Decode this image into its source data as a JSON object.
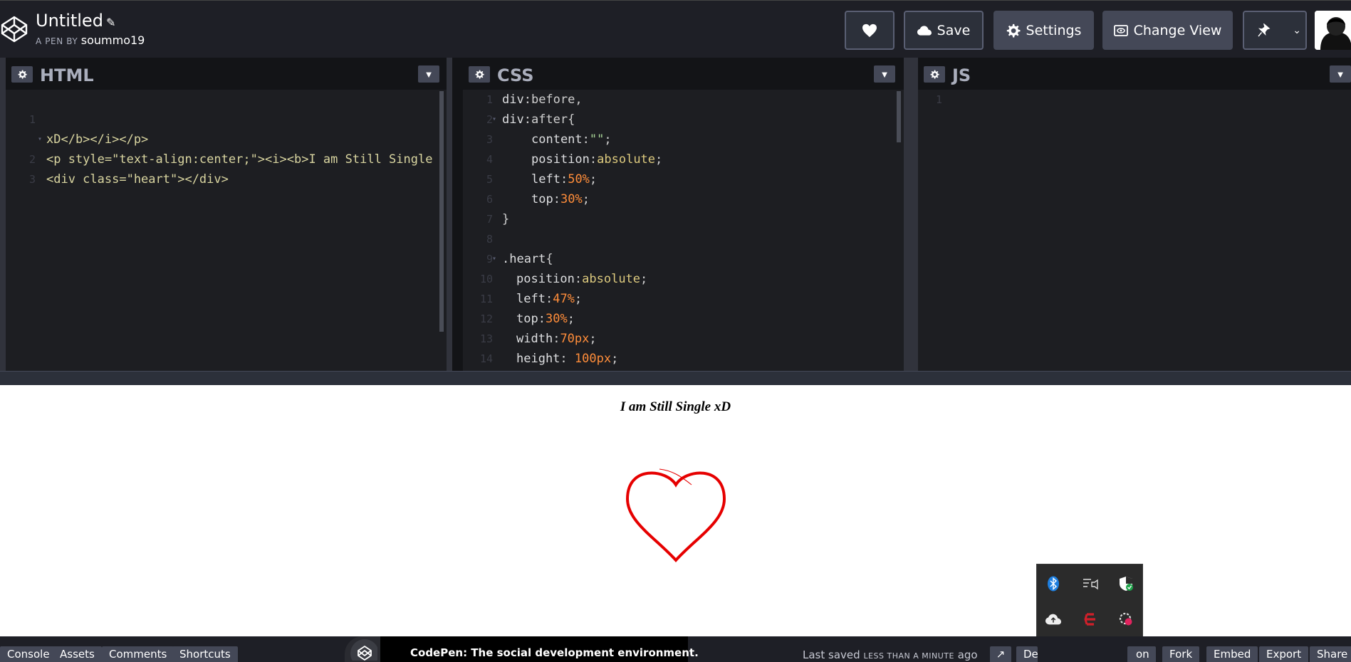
{
  "header": {
    "title": "Untitled",
    "author_prefix": "A PEN BY",
    "author": "soummo19",
    "buttons": {
      "save": "Save",
      "settings": "Settings",
      "change_view": "Change View"
    }
  },
  "panels": [
    {
      "name": "HTML"
    },
    {
      "name": "CSS"
    },
    {
      "name": "JS"
    }
  ],
  "html_code": {
    "line1a": "<p style=\"text-align:center;\"><i><b>I am Still Single",
    "line1b": "xD</b></i></p>",
    "line2": "<div class=\"heart\"></div>"
  },
  "line_numbers": [
    "1",
    "2",
    "3",
    "4",
    "5",
    "6",
    "7",
    "8",
    "9",
    "10",
    "11",
    "12",
    "13",
    "14"
  ],
  "preview": {
    "text": "I am Still Single xD",
    "heart_color": "#e60000"
  },
  "footer": {
    "console": "Console",
    "assets": "Assets",
    "comments": "Comments",
    "shortcuts": "Shortcuts",
    "toast": "CodePen: The social development environment.",
    "last_saved_label": "Last saved",
    "last_saved_rel": "LESS THAN A MINUTE",
    "last_saved_suffix": "ago",
    "de_partial": "De",
    "on_partial": "on",
    "fork": "Fork",
    "embed": "Embed",
    "export": "Export",
    "share": "Share"
  },
  "tray_icons": [
    "bluetooth-icon",
    "media-cast-icon",
    "security-shield-icon",
    "cloud-upload-icon",
    "antivirus-e-icon",
    "settings-badge-icon",
    "snip-tool-icon"
  ],
  "colors": {
    "header_bg": "#1e1f26",
    "editor_bg": "#1d1e22",
    "button_bg": "#444857",
    "css_number": "#ff8d3a",
    "css_value": "#ddca7e",
    "html_string": "#a7d496"
  }
}
